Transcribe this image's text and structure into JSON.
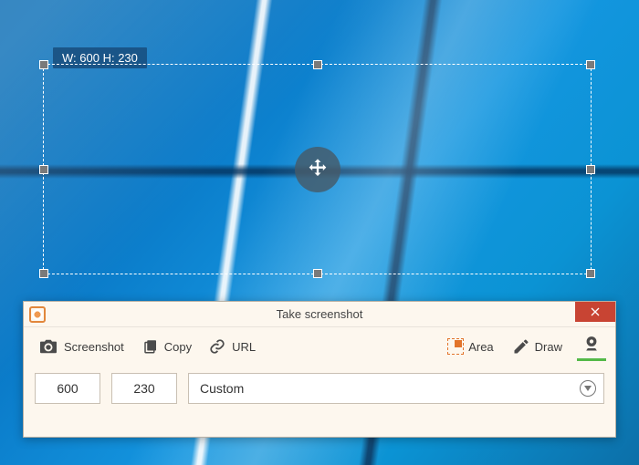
{
  "selection": {
    "size_label_prefix_w": "W: ",
    "size_label_prefix_h": " H: ",
    "width": "600",
    "height": "230"
  },
  "panel": {
    "title": "Take screenshot",
    "toolbar": {
      "screenshot": "Screenshot",
      "copy": "Copy",
      "url": "URL",
      "area": "Area",
      "draw": "Draw"
    },
    "inputs": {
      "width": "600",
      "height": "230",
      "preset": "Custom"
    }
  }
}
